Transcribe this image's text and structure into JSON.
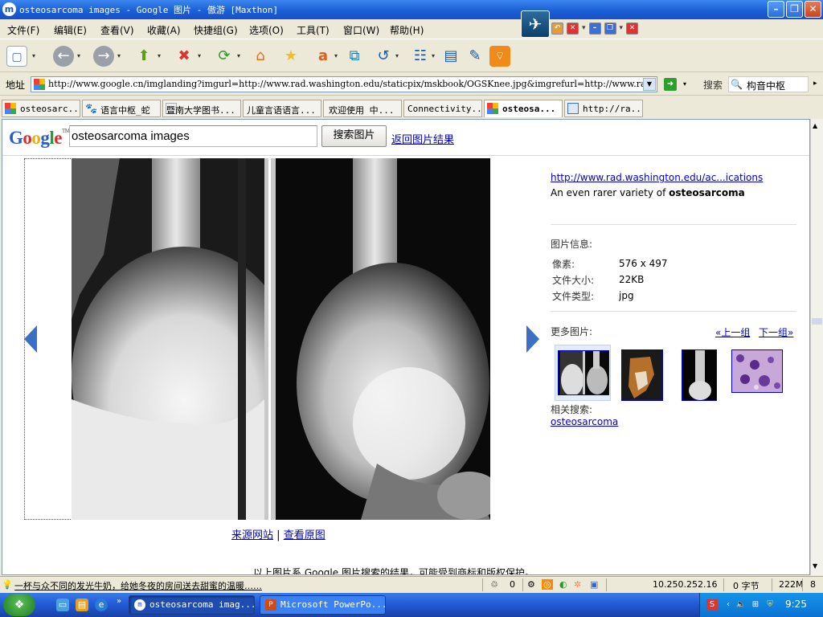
{
  "window": {
    "title": "osteosarcoma images - Google 图片 - 傲游 [Maxthon]",
    "app_icon": "m",
    "logo_icon": "maxthon-logo-icon"
  },
  "menu": [
    "文件(F)",
    "编辑(E)",
    "查看(V)",
    "收藏(A)",
    "快捷组(G)",
    "选项(O)",
    "工具(T)",
    "窗口(W)",
    "帮助(H)"
  ],
  "toolbar_icons": [
    "new-page-icon",
    "back-icon",
    "forward-icon",
    "up-icon",
    "stop-icon",
    "refresh-icon",
    "home-icon",
    "favorites-icon",
    "translate-icon",
    "open-external-icon",
    "undo-icon",
    "settings-icon",
    "sidebar-icon",
    "edit-icon",
    "rss-icon"
  ],
  "address": {
    "label": "地址",
    "url": "http://www.google.cn/imglanding?imgurl=http://www.rad.washington.edu/staticpix/mskbook/OGSKnee.jpg&imgrefurl=http://www.rad"
  },
  "search": {
    "label": "搜索",
    "value": "构音中枢"
  },
  "tabs": [
    {
      "label": "osteosarc...",
      "active": false
    },
    {
      "label": "语言中枢_蛇",
      "active": false
    },
    {
      "label": "暨南大学图书...",
      "active": false
    },
    {
      "label": "儿童言语语言...",
      "active": false
    },
    {
      "label": "欢迎使用 中...",
      "active": false
    },
    {
      "label": "Connectivity...",
      "active": false
    },
    {
      "label": "osteosa...",
      "active": true
    },
    {
      "label": "http://ra...",
      "active": false
    }
  ],
  "page": {
    "logo": "Google",
    "logo_tm": "TM",
    "query": "osteosarcoma images",
    "search_button": "搜索图片",
    "back_link": "返回图片结果",
    "source_link": "来源网站",
    "sep": "|",
    "original_link": "查看原图",
    "footer": "以上图片系 Google 图片搜索的结果，可能受到商标和版权保护。"
  },
  "sidebar": {
    "url": "http://www.rad.washington.edu/ac...ications",
    "desc_prefix": "An even rarer variety of ",
    "desc_bold": "osteosarcoma",
    "info_title": "图片信息:",
    "info": [
      {
        "label": "像素:",
        "value": "576 x 497"
      },
      {
        "label": "文件大小:",
        "value": "22KB"
      },
      {
        "label": "文件类型:",
        "value": "jpg"
      }
    ],
    "more_title": "更多图片:",
    "prev": "«上一组",
    "next": "下一组»",
    "related_title": "相关搜索:",
    "related_link": "osteosarcoma"
  },
  "status": {
    "message": "一杯与众不同的发光牛奶，给她冬夜的房间送去甜蜜的温暖……",
    "count": "0",
    "ip": "10.250.252.16",
    "bytes": "0 字节",
    "memory": "222M",
    "last": "8"
  },
  "taskbar": {
    "tasks": [
      {
        "label": "osteosarcoma imag...",
        "active": true
      },
      {
        "label": "Microsoft PowerPo...",
        "active": false
      }
    ],
    "clock": "9:25"
  },
  "colors": {
    "link": "#0000cc",
    "title_bar": "#1b5fd6",
    "nav_arrow": "#3b6fc6"
  }
}
